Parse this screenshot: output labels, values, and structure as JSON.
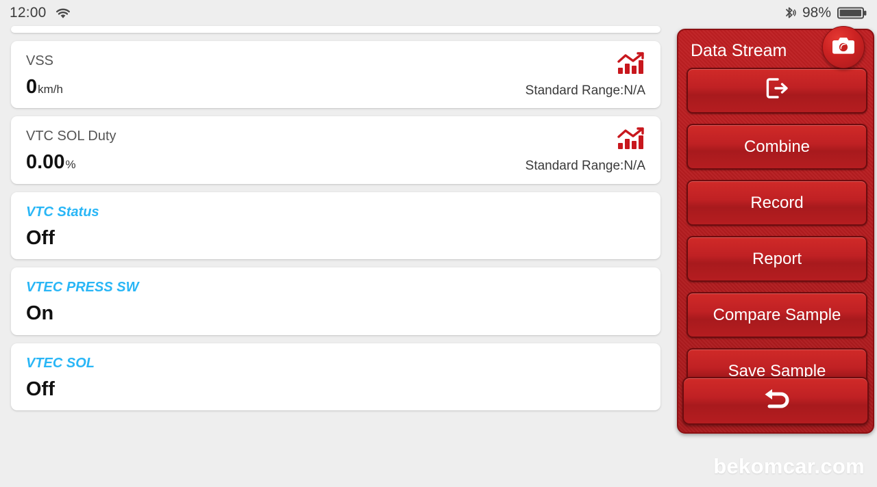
{
  "statusbar": {
    "time": "12:00",
    "wifi_icon": "wifi-icon",
    "bluetooth_icon": "bluetooth-icon",
    "battery_percent": "98%",
    "battery_icon": "battery-icon"
  },
  "list": {
    "clipped_top_card": true,
    "rows": [
      {
        "label": "VSS",
        "label_style": "plain",
        "value": "0",
        "unit": "km/h",
        "range": "Standard Range:N/A",
        "has_chart_icon": true
      },
      {
        "label": "VTC SOL Duty",
        "label_style": "plain",
        "value": "0.00",
        "unit": "%",
        "range": "Standard Range:N/A",
        "has_chart_icon": true
      },
      {
        "label": "VTC Status",
        "label_style": "accent",
        "value": "Off",
        "unit": "",
        "range": "",
        "has_chart_icon": false
      },
      {
        "label": "VTEC PRESS SW",
        "label_style": "accent",
        "value": "On",
        "unit": "",
        "range": "",
        "has_chart_icon": false
      },
      {
        "label": "VTEC SOL",
        "label_style": "accent",
        "value": "Off",
        "unit": "",
        "range": "",
        "has_chart_icon": false
      }
    ]
  },
  "panel": {
    "title": "Data Stream",
    "camera_icon": "camera-icon",
    "exit_icon": "exit-icon",
    "back_icon": "back-arrow-icon",
    "buttons": [
      {
        "label": "",
        "icon": "exit-icon"
      },
      {
        "label": "Combine",
        "icon": ""
      },
      {
        "label": "Record",
        "icon": ""
      },
      {
        "label": "Report",
        "icon": ""
      },
      {
        "label": "Compare Sample",
        "icon": ""
      },
      {
        "label": "Save Sample",
        "icon": ""
      }
    ]
  },
  "watermark": {
    "text": "bekomcar.com"
  },
  "colors": {
    "panel_red": "#b31c1f",
    "button_red": "#c02124",
    "accent_blue": "#29b6f6",
    "chart_icon_red": "#c8171d",
    "page_bg": "#eeeeee",
    "card_bg": "#ffffff"
  }
}
